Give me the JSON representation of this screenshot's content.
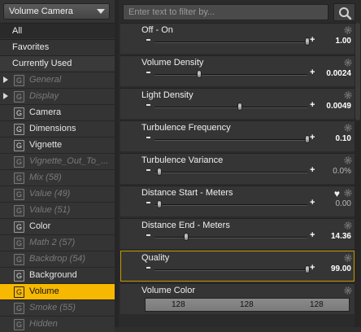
{
  "preset_dropdown": {
    "value": "Volume Camera"
  },
  "categories": [
    {
      "label": "All"
    },
    {
      "label": "Favorites"
    },
    {
      "label": "Currently Used"
    }
  ],
  "tree": [
    {
      "label": "General",
      "expandable": true,
      "dim": true
    },
    {
      "label": "Display",
      "expandable": true,
      "dim": true
    },
    {
      "label": "Camera",
      "expandable": false,
      "dim": false
    },
    {
      "label": "Dimensions",
      "expandable": false,
      "dim": false
    },
    {
      "label": "Vignette",
      "expandable": false,
      "dim": false
    },
    {
      "label": "Vignette_Out_To_...",
      "expandable": false,
      "dim": true
    },
    {
      "label": "Mix (58)",
      "expandable": false,
      "dim": true
    },
    {
      "label": "Value (49)",
      "expandable": false,
      "dim": true
    },
    {
      "label": "Value (51)",
      "expandable": false,
      "dim": true
    },
    {
      "label": "Color",
      "expandable": false,
      "dim": false
    },
    {
      "label": "Math 2 (57)",
      "expandable": false,
      "dim": true
    },
    {
      "label": "Backdrop (54)",
      "expandable": false,
      "dim": true
    },
    {
      "label": "Background",
      "expandable": false,
      "dim": false
    },
    {
      "label": "Volume",
      "expandable": false,
      "dim": false,
      "active": true
    },
    {
      "label": "Smoke (55)",
      "expandable": false,
      "dim": true
    },
    {
      "label": "Hidden",
      "expandable": false,
      "dim": true
    }
  ],
  "group_icon_letter": "G",
  "filter": {
    "placeholder": "Enter text to filter by..."
  },
  "properties": [
    {
      "name": "Off - On",
      "value": "1.00",
      "fraction": 1.0,
      "muted": false
    },
    {
      "name": "Volume Density",
      "value": "0.0024",
      "fraction": 0.29,
      "muted": false
    },
    {
      "name": "Light Density",
      "value": "0.0049",
      "fraction": 0.56,
      "muted": false
    },
    {
      "name": "Turbulence Frequency",
      "value": "0.10",
      "fraction": 1.0,
      "muted": false
    },
    {
      "name": "Turbulence Variance",
      "value": "0.0%",
      "fraction": 0.03,
      "muted": true
    },
    {
      "name": "Distance Start - Meters",
      "value": "0.00",
      "fraction": 0.03,
      "muted": true,
      "favorite": true
    },
    {
      "name": "Distance End - Meters",
      "value": "14.36",
      "fraction": 0.21,
      "muted": false
    },
    {
      "name": "Quality",
      "value": "99.00",
      "fraction": 1.0,
      "muted": false,
      "focused": true
    }
  ],
  "volume_color": {
    "name": "Volume Color",
    "r": "128",
    "g": "128",
    "b": "128"
  },
  "colors": {
    "accent": "#f6b800",
    "panel": "#353535"
  }
}
